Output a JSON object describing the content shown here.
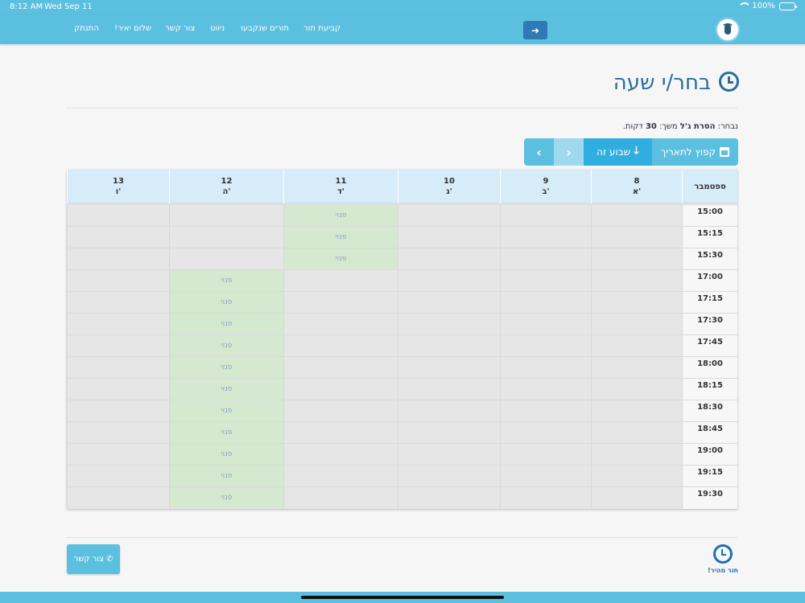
{
  "status": {
    "time": "8:12 AM",
    "date": "Wed Sep 11",
    "battery": "100%"
  },
  "nav": {
    "book": "קביעת תור",
    "booked": "תורים שנקבעו",
    "navigate": "ניווט",
    "contact": "צור קשר",
    "greeting": "שלום יאיר!",
    "logout": "התנתק",
    "arrow": "➜"
  },
  "page": {
    "title": "בחר/י שעה",
    "selected_prefix": "נבחר:",
    "selected_service": "הסרת ג'ל",
    "duration_prefix": "משך:",
    "duration_value": "30",
    "duration_suffix": "דקות."
  },
  "toolbar": {
    "prev": "‹",
    "next": "›",
    "this_week": "שבוע זה",
    "jump": "קפוץ לתאריך"
  },
  "calendar": {
    "month": "ספטמבר",
    "free_label": "פנוי",
    "days": [
      {
        "num": "8",
        "name": "א'"
      },
      {
        "num": "9",
        "name": "ב'"
      },
      {
        "num": "10",
        "name": "ג'"
      },
      {
        "num": "11",
        "name": "ד'"
      },
      {
        "num": "12",
        "name": "ה'"
      },
      {
        "num": "13",
        "name": "ו'"
      }
    ],
    "times": [
      "15:00",
      "15:15",
      "15:30",
      "17:00",
      "17:15",
      "17:30",
      "17:45",
      "18:00",
      "18:15",
      "18:30",
      "18:45",
      "19:00",
      "19:15",
      "19:30"
    ]
  },
  "footer": {
    "contact": "צור קשר",
    "quick": "תור מהיר!"
  }
}
